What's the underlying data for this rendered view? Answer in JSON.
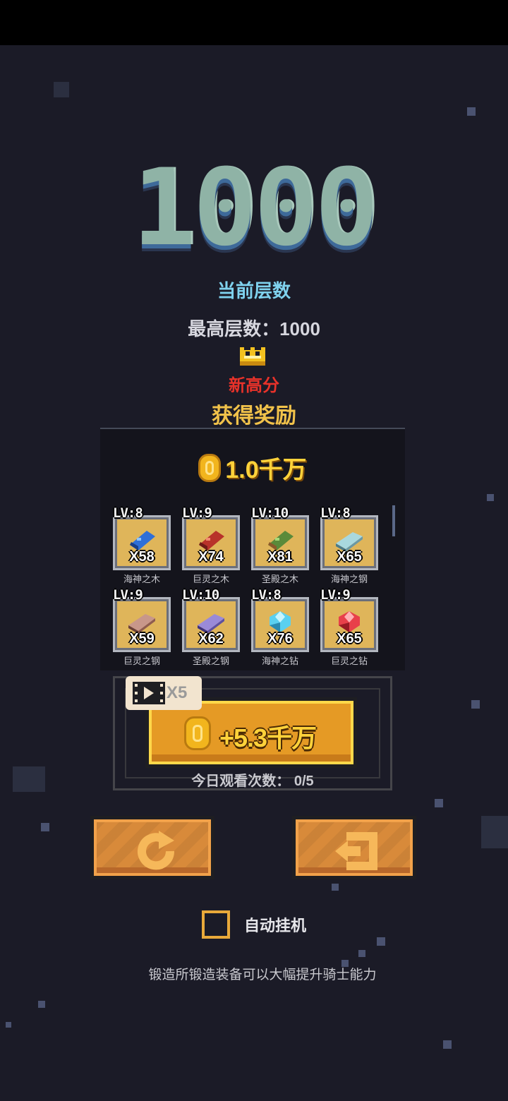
{
  "score": {
    "current_floor": "1000",
    "current_floor_label": "当前层数",
    "best_floor_text": "最高层数：1000",
    "new_high_label": "新高分"
  },
  "reward": {
    "title": "获得奖励",
    "coins": "1.0千万",
    "items": [
      {
        "lv": "LV:8",
        "qty": "X58",
        "name": "海神之木",
        "icon": "blue-wood"
      },
      {
        "lv": "LV:9",
        "qty": "X74",
        "name": "巨灵之木",
        "icon": "red-wood"
      },
      {
        "lv": "LV:10",
        "qty": "X81",
        "name": "圣殿之木",
        "icon": "green-wood"
      },
      {
        "lv": "LV:8",
        "qty": "X65",
        "name": "海神之钢",
        "icon": "silver-ingot"
      },
      {
        "lv": "LV:9",
        "qty": "X59",
        "name": "巨灵之钢",
        "icon": "copper-ingot"
      },
      {
        "lv": "LV:10",
        "qty": "X62",
        "name": "圣殿之钢",
        "icon": "purple-ingot"
      },
      {
        "lv": "LV:8",
        "qty": "X76",
        "name": "海神之钻",
        "icon": "cyan-gem"
      },
      {
        "lv": "LV:9",
        "qty": "X65",
        "name": "巨灵之钻",
        "icon": "red-gem"
      }
    ]
  },
  "video_bonus": {
    "times_label": "X5",
    "bonus": "+5.3千万",
    "watch_count": "今日观看次数：  0/5"
  },
  "actions": {
    "retry_icon": "refresh-icon",
    "exit_icon": "exit-icon"
  },
  "auto_idle": {
    "label": "自动挂机",
    "checked": false
  },
  "tip": "锻造所锻造装备可以大幅提升骑士能力",
  "colors": {
    "background": "#1b1b27",
    "accent_gold": "#ffd23a",
    "new_high_red": "#e8322a",
    "floor_label_cyan": "#7fd2ee"
  }
}
